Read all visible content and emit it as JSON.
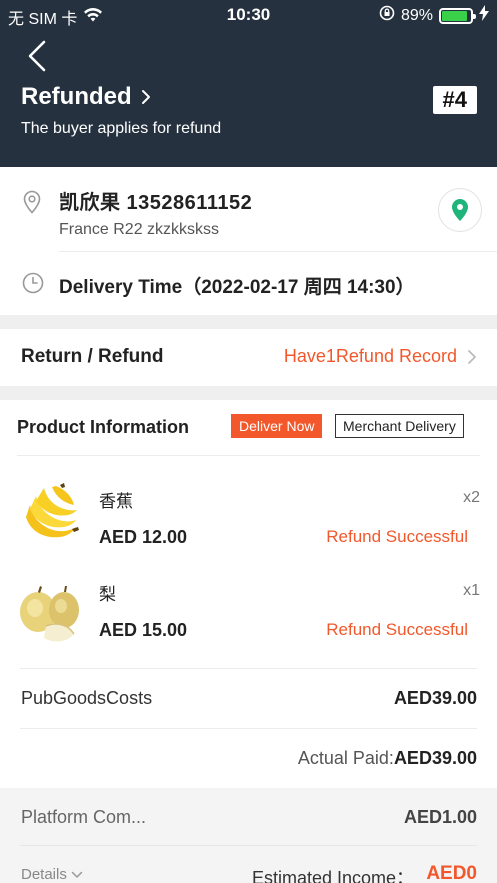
{
  "status_bar": {
    "carrier": "无 SIM 卡",
    "time": "10:30",
    "battery": "89%",
    "battery_level": 0.89,
    "icons": [
      "wifi-icon",
      "rotation-lock-icon",
      "battery-icon",
      "charging-icon"
    ]
  },
  "header": {
    "title": "Refunded",
    "subtitle": "The buyer applies for refund",
    "order_number": "#4"
  },
  "address": {
    "name_phone": "凯欣果   13528611152",
    "address_line": "France R22 zkzkkskss",
    "delivery_time": "Delivery Time（2022-02-17 周四 14:30）"
  },
  "refund": {
    "label": "Return / Refund",
    "link": "Have1Refund Record"
  },
  "products": {
    "title": "Product Information",
    "deliver_now": "Deliver Now",
    "merchant_delivery": "Merchant Delivery",
    "items": [
      {
        "name": "香蕉",
        "qty": "x2",
        "price": "AED 12.00",
        "status": "Refund Successful",
        "image": "banana"
      },
      {
        "name": "梨",
        "qty": "x1",
        "price": "AED 15.00",
        "status": "Refund Successful",
        "image": "pear"
      }
    ]
  },
  "summary": {
    "goods_costs_label": "PubGoodsCosts",
    "goods_costs_value": "AED39.00",
    "actual_paid_label": "Actual Paid:",
    "actual_paid_value": "AED39.00",
    "platform_label": "Platform Com...",
    "platform_value": "AED1.00",
    "details_label": "Details",
    "estimated_label": "Estimated Income：",
    "estimated_value": "AED0"
  },
  "colors": {
    "header_bg": "#25313e",
    "accent": "#f2582b",
    "map_pin": "#1fb57a",
    "battery": "#3ad14a"
  }
}
